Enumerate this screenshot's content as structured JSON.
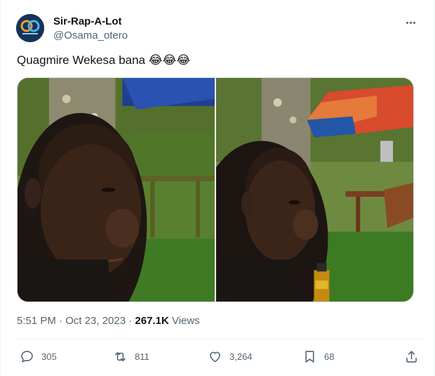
{
  "author": {
    "name": "Sir-Rap-A-Lot",
    "handle": "@Osama_otero",
    "avatar_icon": "logo-avatar"
  },
  "tweet": {
    "text": "Quagmire Wekesa bana",
    "emojis": "😂😂😂"
  },
  "media": {
    "photos": [
      {
        "icon": "photo-man-left"
      },
      {
        "icon": "photo-man-right"
      }
    ]
  },
  "meta": {
    "timestamp": "5:51 PM · Oct 23, 2023 · ",
    "views_count": "267.1K",
    "views_label": " Views"
  },
  "actions": {
    "replies": "305",
    "retweets": "811",
    "likes": "3,264",
    "bookmarks": "68"
  },
  "colors": {
    "text_primary": "#0f1419",
    "text_secondary": "#536471",
    "border": "#cfd9de"
  }
}
